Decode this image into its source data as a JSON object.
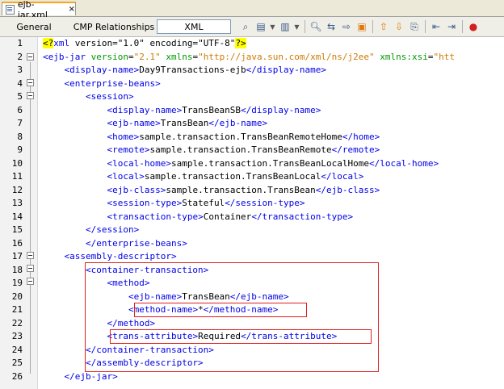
{
  "file_tab": {
    "label": "ejb-jar.xml",
    "close": "×"
  },
  "toolbar": {
    "tabs": [
      "General",
      "CMP Relationships",
      "XML"
    ],
    "icons": [
      "find-icon",
      "back-icon",
      "forward-icon",
      "stop-icon",
      "search-icon",
      "replace-icon",
      "find-next-icon",
      "toggle-highlight-icon",
      "prev-bookmark-icon",
      "next-bookmark-icon",
      "toggle-bookmark-icon",
      "shift-left-icon",
      "shift-right-icon",
      "record-macro-icon"
    ]
  },
  "lines": [
    {
      "n": "1",
      "parts": [
        {
          "c": "pi",
          "t": "<?"
        },
        {
          "c": "tag",
          "t": "xml"
        },
        {
          "c": "txt",
          "t": " version=\"1.0\" encoding=\"UTF-8\""
        },
        {
          "c": "pi",
          "t": "?>"
        }
      ]
    },
    {
      "n": "2",
      "parts": [
        {
          "c": "tag",
          "t": "<ejb-jar"
        },
        {
          "c": "attr",
          "t": " version"
        },
        {
          "c": "eq",
          "t": "="
        },
        {
          "c": "val",
          "t": "\"2.1\""
        },
        {
          "c": "attr",
          "t": " xmlns"
        },
        {
          "c": "eq",
          "t": "="
        },
        {
          "c": "val",
          "t": "\"http://java.sun.com/xml/ns/j2ee\""
        },
        {
          "c": "attr",
          "t": " xmlns:xsi"
        },
        {
          "c": "eq",
          "t": "="
        },
        {
          "c": "val",
          "t": "\"htt"
        }
      ]
    },
    {
      "n": "3",
      "parts": [
        {
          "c": "txt",
          "t": "    "
        },
        {
          "c": "tag",
          "t": "<display-name>"
        },
        {
          "c": "txt",
          "t": "Day9Transactions-ejb"
        },
        {
          "c": "tag",
          "t": "</display-name>"
        }
      ]
    },
    {
      "n": "4",
      "parts": [
        {
          "c": "txt",
          "t": "    "
        },
        {
          "c": "tag",
          "t": "<enterprise-beans>"
        }
      ]
    },
    {
      "n": "5",
      "parts": [
        {
          "c": "txt",
          "t": "        "
        },
        {
          "c": "tag",
          "t": "<session>"
        }
      ]
    },
    {
      "n": "6",
      "parts": [
        {
          "c": "txt",
          "t": "            "
        },
        {
          "c": "tag",
          "t": "<display-name>"
        },
        {
          "c": "txt",
          "t": "TransBeanSB"
        },
        {
          "c": "tag",
          "t": "</display-name>"
        }
      ]
    },
    {
      "n": "7",
      "parts": [
        {
          "c": "txt",
          "t": "            "
        },
        {
          "c": "tag",
          "t": "<ejb-name>"
        },
        {
          "c": "txt",
          "t": "TransBean"
        },
        {
          "c": "tag",
          "t": "</ejb-name>"
        }
      ]
    },
    {
      "n": "8",
      "parts": [
        {
          "c": "txt",
          "t": "            "
        },
        {
          "c": "tag",
          "t": "<home>"
        },
        {
          "c": "txt",
          "t": "sample.transaction.TransBeanRemoteHome"
        },
        {
          "c": "tag",
          "t": "</home>"
        }
      ]
    },
    {
      "n": "9",
      "parts": [
        {
          "c": "txt",
          "t": "            "
        },
        {
          "c": "tag",
          "t": "<remote>"
        },
        {
          "c": "txt",
          "t": "sample.transaction.TransBeanRemote"
        },
        {
          "c": "tag",
          "t": "</remote>"
        }
      ]
    },
    {
      "n": "10",
      "parts": [
        {
          "c": "txt",
          "t": "            "
        },
        {
          "c": "tag",
          "t": "<local-home>"
        },
        {
          "c": "txt",
          "t": "sample.transaction.TransBeanLocalHome"
        },
        {
          "c": "tag",
          "t": "</local-home>"
        }
      ]
    },
    {
      "n": "11",
      "parts": [
        {
          "c": "txt",
          "t": "            "
        },
        {
          "c": "tag",
          "t": "<local>"
        },
        {
          "c": "txt",
          "t": "sample.transaction.TransBeanLocal"
        },
        {
          "c": "tag",
          "t": "</local>"
        }
      ]
    },
    {
      "n": "12",
      "parts": [
        {
          "c": "txt",
          "t": "            "
        },
        {
          "c": "tag",
          "t": "<ejb-class>"
        },
        {
          "c": "txt",
          "t": "sample.transaction.TransBean"
        },
        {
          "c": "tag",
          "t": "</ejb-class>"
        }
      ]
    },
    {
      "n": "13",
      "parts": [
        {
          "c": "txt",
          "t": "            "
        },
        {
          "c": "tag",
          "t": "<session-type>"
        },
        {
          "c": "txt",
          "t": "Stateful"
        },
        {
          "c": "tag",
          "t": "</session-type>"
        }
      ]
    },
    {
      "n": "14",
      "parts": [
        {
          "c": "txt",
          "t": "            "
        },
        {
          "c": "tag",
          "t": "<transaction-type>"
        },
        {
          "c": "txt",
          "t": "Container"
        },
        {
          "c": "tag",
          "t": "</transaction-type>"
        }
      ]
    },
    {
      "n": "15",
      "parts": [
        {
          "c": "txt",
          "t": "        "
        },
        {
          "c": "tag",
          "t": "</session>"
        }
      ]
    },
    {
      "n": "16",
      "parts": [
        {
          "c": "txt",
          "t": "        "
        },
        {
          "c": "tag",
          "t": "</enterprise-beans>"
        }
      ]
    },
    {
      "n": "17",
      "parts": [
        {
          "c": "txt",
          "t": "    "
        },
        {
          "c": "tag",
          "t": "<assembly-descriptor>"
        }
      ]
    },
    {
      "n": "18",
      "parts": [
        {
          "c": "txt",
          "t": "        "
        },
        {
          "c": "tag",
          "t": "<container-transaction>"
        }
      ]
    },
    {
      "n": "19",
      "parts": [
        {
          "c": "txt",
          "t": "            "
        },
        {
          "c": "tag",
          "t": "<method>"
        }
      ]
    },
    {
      "n": "20",
      "parts": [
        {
          "c": "txt",
          "t": "                "
        },
        {
          "c": "tag",
          "t": "<ejb-name>"
        },
        {
          "c": "txt",
          "t": "TransBean"
        },
        {
          "c": "tag",
          "t": "</ejb-name>"
        }
      ]
    },
    {
      "n": "21",
      "parts": [
        {
          "c": "txt",
          "t": "                "
        },
        {
          "c": "tag",
          "t": "<method-name>"
        },
        {
          "c": "txt",
          "t": "*"
        },
        {
          "c": "tag",
          "t": "</method-name>"
        }
      ]
    },
    {
      "n": "22",
      "parts": [
        {
          "c": "txt",
          "t": "            "
        },
        {
          "c": "tag",
          "t": "</method>"
        }
      ]
    },
    {
      "n": "23",
      "parts": [
        {
          "c": "txt",
          "t": "            "
        },
        {
          "c": "tag",
          "t": "<trans-attribute>"
        },
        {
          "c": "txt",
          "t": "Required"
        },
        {
          "c": "tag",
          "t": "</trans-attribute>"
        }
      ]
    },
    {
      "n": "24",
      "parts": [
        {
          "c": "txt",
          "t": "        "
        },
        {
          "c": "tag",
          "t": "</container-transaction>"
        }
      ]
    },
    {
      "n": "25",
      "parts": [
        {
          "c": "txt",
          "t": "        "
        },
        {
          "c": "tag",
          "t": "</assembly-descriptor>"
        }
      ]
    },
    {
      "n": "26",
      "parts": [
        {
          "c": "txt",
          "t": "    "
        },
        {
          "c": "tag",
          "t": "</ejb-jar>"
        }
      ]
    }
  ],
  "colors": {
    "tag": "#0000e6",
    "attribute": "#009900",
    "value": "#ce7b00",
    "highlight_box": "#e02020"
  }
}
